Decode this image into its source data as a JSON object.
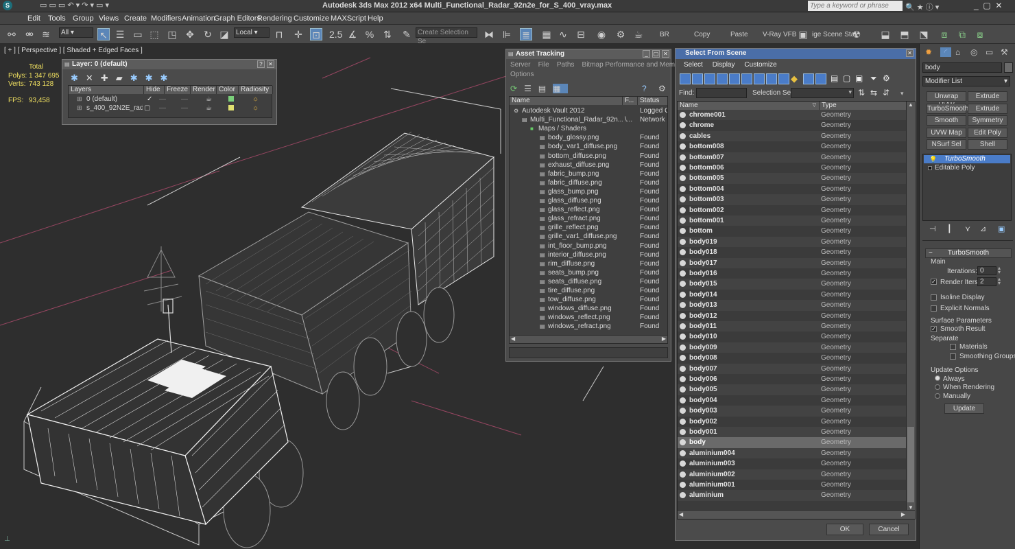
{
  "app": {
    "title": "Autodesk 3ds Max  2012 x64      Multi_Functional_Radar_92n2e_for_S_400_vray.max",
    "search_placeholder": "Type a keyword or phrase"
  },
  "menu": [
    "Edit",
    "Tools",
    "Group",
    "Views",
    "Create",
    "Modifiers",
    "Animation",
    "Graph Editors",
    "Rendering",
    "Customize",
    "MAXScript",
    "Help"
  ],
  "toolbar": {
    "filter_value": "All",
    "ref_coord_value": "Local",
    "selection_set_placeholder": "Create Selection Se",
    "br_label": "BR",
    "copy_label": "Copy",
    "paste_label": "Paste",
    "vray_vfb_label": "V-Ray VFB",
    "scene_states_label": "ige Scene Stat"
  },
  "viewport": {
    "label": "[ + ] [ Perspective ] [ Shaded + Edged Faces ]",
    "stats": {
      "total_label": "Total",
      "polys_label": "Polys:",
      "polys_value": "1 347 695",
      "verts_label": "Verts:",
      "verts_value": "743 128",
      "fps_label": "FPS:",
      "fps_value": "93,458"
    }
  },
  "layer_window": {
    "title": "Layer: 0 (default)",
    "columns": [
      "Layers",
      "Hide",
      "Freeze",
      "Render",
      "Color",
      "Radiosity"
    ],
    "rows": [
      {
        "name": "0 (default)",
        "color": "#7ad07a"
      },
      {
        "name": "s_400_92N2E_radar",
        "color": "#e0e070"
      }
    ]
  },
  "asset_tracking": {
    "title": "Asset Tracking",
    "menu": [
      "Server",
      "File",
      "Paths",
      "Bitmap Performance and Memory",
      "Options"
    ],
    "columns": [
      "Name",
      "F...",
      "Status"
    ],
    "rows": [
      {
        "name": "Autodesk Vault 2012",
        "f": "",
        "status": "Logged Out",
        "indent": 1
      },
      {
        "name": "Multi_Functional_Radar_92n...",
        "f": "\\...",
        "status": "Network Pa",
        "indent": 2
      },
      {
        "name": "Maps / Shaders",
        "f": "",
        "status": "",
        "indent": 3
      },
      {
        "name": "body_glossy.png",
        "f": "",
        "status": "Found",
        "indent": 4
      },
      {
        "name": "body_var1_diffuse.png",
        "f": "",
        "status": "Found",
        "indent": 4
      },
      {
        "name": "bottom_diffuse.png",
        "f": "",
        "status": "Found",
        "indent": 4
      },
      {
        "name": "exhaust_diffuse.png",
        "f": "",
        "status": "Found",
        "indent": 4
      },
      {
        "name": "fabric_bump.png",
        "f": "",
        "status": "Found",
        "indent": 4
      },
      {
        "name": "fabric_diffuse.png",
        "f": "",
        "status": "Found",
        "indent": 4
      },
      {
        "name": "glass_bump.png",
        "f": "",
        "status": "Found",
        "indent": 4
      },
      {
        "name": "glass_diffuse.png",
        "f": "",
        "status": "Found",
        "indent": 4
      },
      {
        "name": "glass_reflect.png",
        "f": "",
        "status": "Found",
        "indent": 4
      },
      {
        "name": "glass_refract.png",
        "f": "",
        "status": "Found",
        "indent": 4
      },
      {
        "name": "grille_reflect.png",
        "f": "",
        "status": "Found",
        "indent": 4
      },
      {
        "name": "grille_var1_diffuse.png",
        "f": "",
        "status": "Found",
        "indent": 4
      },
      {
        "name": "int_floor_bump.png",
        "f": "",
        "status": "Found",
        "indent": 4
      },
      {
        "name": "interior_diffuse.png",
        "f": "",
        "status": "Found",
        "indent": 4
      },
      {
        "name": "rim_diffuse.png",
        "f": "",
        "status": "Found",
        "indent": 4
      },
      {
        "name": "seats_bump.png",
        "f": "",
        "status": "Found",
        "indent": 4
      },
      {
        "name": "seats_diffuse.png",
        "f": "",
        "status": "Found",
        "indent": 4
      },
      {
        "name": "tire_diffuse.png",
        "f": "",
        "status": "Found",
        "indent": 4
      },
      {
        "name": "tow_diffuse.png",
        "f": "",
        "status": "Found",
        "indent": 4
      },
      {
        "name": "windows_diffuse.png",
        "f": "",
        "status": "Found",
        "indent": 4
      },
      {
        "name": "windows_reflect.png",
        "f": "",
        "status": "Found",
        "indent": 4
      },
      {
        "name": "windows_refract.png",
        "f": "",
        "status": "Found",
        "indent": 4
      }
    ]
  },
  "select_from_scene": {
    "title": "Select From Scene",
    "menu": [
      "Select",
      "Display",
      "Customize"
    ],
    "find_label": "Find:",
    "selection_set_label": "Selection Set:",
    "columns": [
      "Name",
      "Type"
    ],
    "rows": [
      {
        "name": "chrome001",
        "type": "Geometry"
      },
      {
        "name": "chrome",
        "type": "Geometry"
      },
      {
        "name": "cables",
        "type": "Geometry"
      },
      {
        "name": "bottom008",
        "type": "Geometry"
      },
      {
        "name": "bottom007",
        "type": "Geometry"
      },
      {
        "name": "bottom006",
        "type": "Geometry"
      },
      {
        "name": "bottom005",
        "type": "Geometry"
      },
      {
        "name": "bottom004",
        "type": "Geometry"
      },
      {
        "name": "bottom003",
        "type": "Geometry"
      },
      {
        "name": "bottom002",
        "type": "Geometry"
      },
      {
        "name": "bottom001",
        "type": "Geometry"
      },
      {
        "name": "bottom",
        "type": "Geometry"
      },
      {
        "name": "body019",
        "type": "Geometry"
      },
      {
        "name": "body018",
        "type": "Geometry"
      },
      {
        "name": "body017",
        "type": "Geometry"
      },
      {
        "name": "body016",
        "type": "Geometry"
      },
      {
        "name": "body015",
        "type": "Geometry"
      },
      {
        "name": "body014",
        "type": "Geometry"
      },
      {
        "name": "body013",
        "type": "Geometry"
      },
      {
        "name": "body012",
        "type": "Geometry"
      },
      {
        "name": "body011",
        "type": "Geometry"
      },
      {
        "name": "body010",
        "type": "Geometry"
      },
      {
        "name": "body009",
        "type": "Geometry"
      },
      {
        "name": "body008",
        "type": "Geometry"
      },
      {
        "name": "body007",
        "type": "Geometry"
      },
      {
        "name": "body006",
        "type": "Geometry"
      },
      {
        "name": "body005",
        "type": "Geometry"
      },
      {
        "name": "body004",
        "type": "Geometry"
      },
      {
        "name": "body003",
        "type": "Geometry"
      },
      {
        "name": "body002",
        "type": "Geometry"
      },
      {
        "name": "body001",
        "type": "Geometry"
      },
      {
        "name": "body",
        "type": "Geometry",
        "selected": true
      },
      {
        "name": "aluminium004",
        "type": "Geometry"
      },
      {
        "name": "aluminium003",
        "type": "Geometry"
      },
      {
        "name": "aluminium002",
        "type": "Geometry"
      },
      {
        "name": "aluminium001",
        "type": "Geometry"
      },
      {
        "name": "aluminium",
        "type": "Geometry"
      }
    ],
    "ok_label": "OK",
    "cancel_label": "Cancel"
  },
  "command_panel": {
    "object_name": "body",
    "modifier_list_label": "Modifier List",
    "buttons": [
      [
        "Unwrap UVW",
        "Extrude"
      ],
      [
        "TurboSmooth",
        "Extrude"
      ],
      [
        "Smooth",
        "Symmetry"
      ],
      [
        "UVW Map",
        "Edit Poly"
      ],
      [
        "NSurf Sel",
        "Shell"
      ]
    ],
    "stack": [
      {
        "name": "TurboSmooth",
        "active": true
      },
      {
        "name": "Editable Poly",
        "active": false
      }
    ],
    "rollout": {
      "title": "TurboSmooth",
      "main_label": "Main",
      "iterations_label": "Iterations:",
      "iterations_value": "0",
      "render_iters_label": "Render Iters:",
      "render_iters_value": "2",
      "isoline_label": "Isoline Display",
      "explicit_normals_label": "Explicit Normals",
      "surface_params_label": "Surface Parameters",
      "smooth_result_label": "Smooth Result",
      "separate_label": "Separate",
      "materials_label": "Materials",
      "smoothing_groups_label": "Smoothing Groups",
      "update_options_label": "Update Options",
      "always_label": "Always",
      "when_rendering_label": "When Rendering",
      "manually_label": "Manually",
      "update_button": "Update"
    }
  }
}
